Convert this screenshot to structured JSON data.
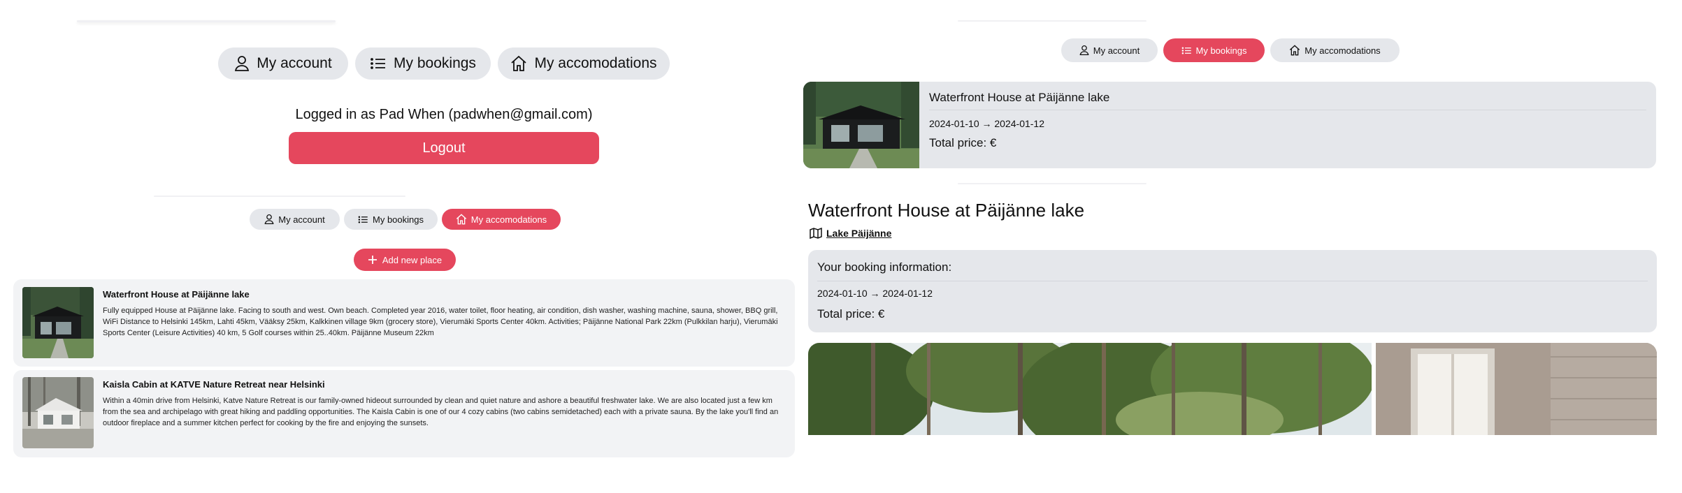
{
  "left_top": {
    "nav": {
      "account": "My account",
      "bookings": "My bookings",
      "accommodations": "My accomodations"
    },
    "logged_in_text": "Logged in as Pad When (padwhen@gmail.com)",
    "logout_label": "Logout"
  },
  "left_bottom": {
    "nav": {
      "account": "My account",
      "bookings": "My bookings",
      "accommodations": "My accomodations",
      "active": "accommodations"
    },
    "add_button": "Add new place",
    "places": [
      {
        "title": "Waterfront House at Päijänne lake",
        "description": "Fully equipped House at Päijänne lake. Facing to south and west. Own beach. Completed year 2016, water toilet, floor heating, air condition, dish washer, washing machine, sauna, shower, BBQ grill, WiFi Distance to Helsinki 145km, Lahti 45km, Vääksy 25km, Kalkkinen village 9km (grocery store), Vierumäki Sports Center 40km. Activities; Päijänne National Park 22km (Pulkkilan harju), Vierumäki Sports Center (Leisure Activities) 40 km, 5 Golf courses within 25..40km. Päijänne Museum 22km"
      },
      {
        "title": "Kaisla Cabin at KATVE Nature Retreat near Helsinki",
        "description": "Within a 40min drive from Helsinki, Katve Nature Retreat is our family-owned hideout surrounded by clean and quiet nature and ashore a beautiful freshwater lake. We are also located just a few km from the sea and archipelago with great hiking and paddling opportunities. The Kaisla Cabin is one of our 4 cozy cabins (two cabins semidetached) each with a private sauna. By the lake you'll find an outdoor fireplace and a summer kitchen perfect for cooking by the fire and enjoying the sunsets."
      }
    ]
  },
  "right": {
    "nav": {
      "account": "My account",
      "bookings": "My bookings",
      "accommodations": "My accomodations",
      "active": "bookings"
    },
    "booking_card": {
      "title": "Waterfront House at Päijänne lake",
      "dates": "2024-01-10 → 2024-01-12",
      "total": "Total price: €"
    },
    "detail": {
      "title": "Waterfront House at Päijänne lake",
      "location": "Lake Päijänne",
      "info_heading": "Your booking information:",
      "dates": "2024-01-10 → 2024-01-12",
      "total": "Total price: €"
    }
  },
  "colors": {
    "accent": "#e5475d",
    "pill_bg": "#e5e7eb",
    "card_bg": "#f2f3f5"
  },
  "icons": [
    "user-icon",
    "list-icon",
    "home-icon",
    "plus-icon",
    "map-icon"
  ]
}
